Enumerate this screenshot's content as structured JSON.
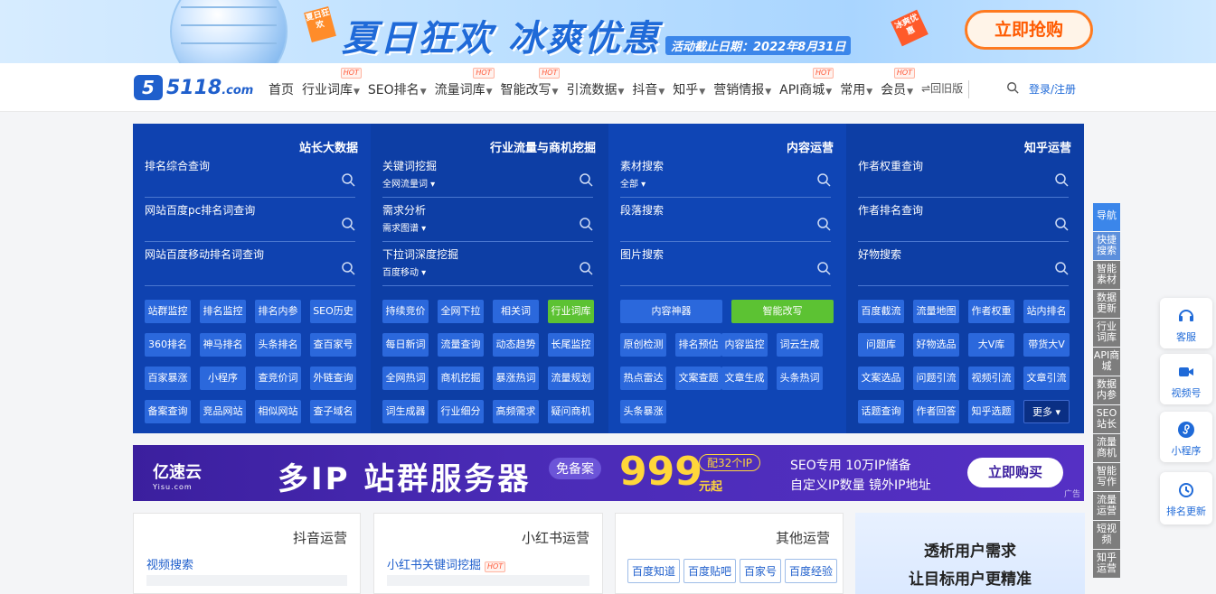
{
  "banner": {
    "tag_left": "夏日狂欢",
    "headline": "夏日狂欢 冰爽优惠",
    "deadline": "活动截止日期：2022年8月31日",
    "tag_right": "冰爽优惠",
    "buy_label": "立即抢购"
  },
  "logo": {
    "mark": "5",
    "text": "5118",
    "suffix": ".com"
  },
  "nav": {
    "items": [
      {
        "label": "首页",
        "caret": false,
        "hot": false
      },
      {
        "label": "行业词库",
        "caret": true,
        "hot": true
      },
      {
        "label": "SEO排名",
        "caret": true,
        "hot": false
      },
      {
        "label": "流量词库",
        "caret": true,
        "hot": true
      },
      {
        "label": "智能改写",
        "caret": true,
        "hot": true
      },
      {
        "label": "引流数据",
        "caret": true,
        "hot": false
      },
      {
        "label": "抖音",
        "caret": true,
        "hot": false
      },
      {
        "label": "知乎",
        "caret": true,
        "hot": false
      },
      {
        "label": "营销情报",
        "caret": true,
        "hot": false
      },
      {
        "label": "API商城",
        "caret": true,
        "hot": true
      },
      {
        "label": "常用",
        "caret": true,
        "hot": false
      },
      {
        "label": "会员",
        "caret": true,
        "hot": true
      }
    ],
    "old_version": "⇌回旧版",
    "hot_label": "HOT",
    "login": "登录/注册"
  },
  "panel": {
    "c1": {
      "title": "站长大数据",
      "queries": [
        {
          "label": "排名综合查询"
        },
        {
          "label": "网站百度pc排名词查询"
        },
        {
          "label": "网站百度移动排名词查询"
        }
      ],
      "buttons": [
        "站群监控",
        "排名监控",
        "排名内参",
        "SEO历史",
        "360排名",
        "神马排名",
        "头条排名",
        "查百家号",
        "百家暴涨",
        "小程序",
        "查竞价词",
        "外链查询",
        "备案查询",
        "竞品网站",
        "相似网站",
        "查子域名"
      ]
    },
    "c2": {
      "title": "行业流量与商机挖掘",
      "queries": [
        {
          "label": "关键词挖掘",
          "sub": "全网流量词"
        },
        {
          "label": "需求分析",
          "sub": "需求图谱"
        },
        {
          "label": "下拉词深度挖掘",
          "sub": "百度移动"
        }
      ],
      "buttons": [
        "持续竞价",
        "全网下拉",
        "相关词",
        "行业词库",
        "每日新词",
        "流量查询",
        "动态趋势",
        "长尾监控",
        "全网热词",
        "商机挖掘",
        "暴涨热词",
        "流量规划",
        "词生成器",
        "行业细分",
        "高频需求",
        "疑问商机"
      ]
    },
    "c3": {
      "title": "内容运营",
      "queries": [
        {
          "label": "素材搜索",
          "sub": "全部"
        },
        {
          "label": "段落搜索"
        },
        {
          "label": "图片搜索"
        }
      ],
      "wide_buttons": [
        "内容神器",
        "智能改写"
      ],
      "buttons": [
        "原创检测",
        "排名预估",
        "内容监控",
        "词云生成",
        "热点雷达",
        "文案查题",
        "文章生成",
        "头条热词",
        "头条暴涨"
      ]
    },
    "c4": {
      "title": "知乎运营",
      "queries": [
        {
          "label": "作者权重查询"
        },
        {
          "label": "作者排名查询"
        },
        {
          "label": "好物搜索"
        }
      ],
      "buttons": [
        "百度截流",
        "流量地图",
        "作者权重",
        "站内排名",
        "问题库",
        "好物选品",
        "大V库",
        "带货大V",
        "文案选品",
        "问题引流",
        "视频引流",
        "文章引流",
        "话题查询",
        "作者回答",
        "知乎选题"
      ],
      "more": "更多"
    }
  },
  "ad": {
    "brand": "亿速云",
    "brand_sub": "Yisu.com",
    "headline": "多IP 站群服务器",
    "pill": "免备案",
    "price": "999",
    "ip_count": "配32个IP",
    "price_unit": "元起",
    "line1": "SEO专用   10万IP储备",
    "line2": "自定义IP数量   镜外IP地址",
    "cta": "立即购买",
    "ad_tag": "广告"
  },
  "cards": {
    "douyin": {
      "title": "抖音运营",
      "link": "视频搜索"
    },
    "xhs": {
      "title": "小红书运营",
      "link": "小红书关键词挖掘"
    },
    "other": {
      "title": "其他运营",
      "tags": [
        "百度知道",
        "百度贴吧",
        "百家号",
        "百度经验"
      ]
    },
    "promo": {
      "line1": "透析用户需求",
      "line2": "让目标用户更精准"
    }
  },
  "sidenav": [
    "导航",
    "快捷搜索",
    "智能素材",
    "数据更新",
    "行业词库",
    "API商城",
    "数据内参",
    "SEO站长",
    "流量商机",
    "智能写作",
    "流量运营",
    "短视频",
    "知乎运营"
  ],
  "float": [
    "客服",
    "视频号",
    "小程序",
    "排名更新"
  ],
  "colors": {
    "brand": "#1f5fcc",
    "panel": "#0f45b5",
    "button": "#2b68dc",
    "green": "#5cc233",
    "orange": "#ff7a1f"
  }
}
